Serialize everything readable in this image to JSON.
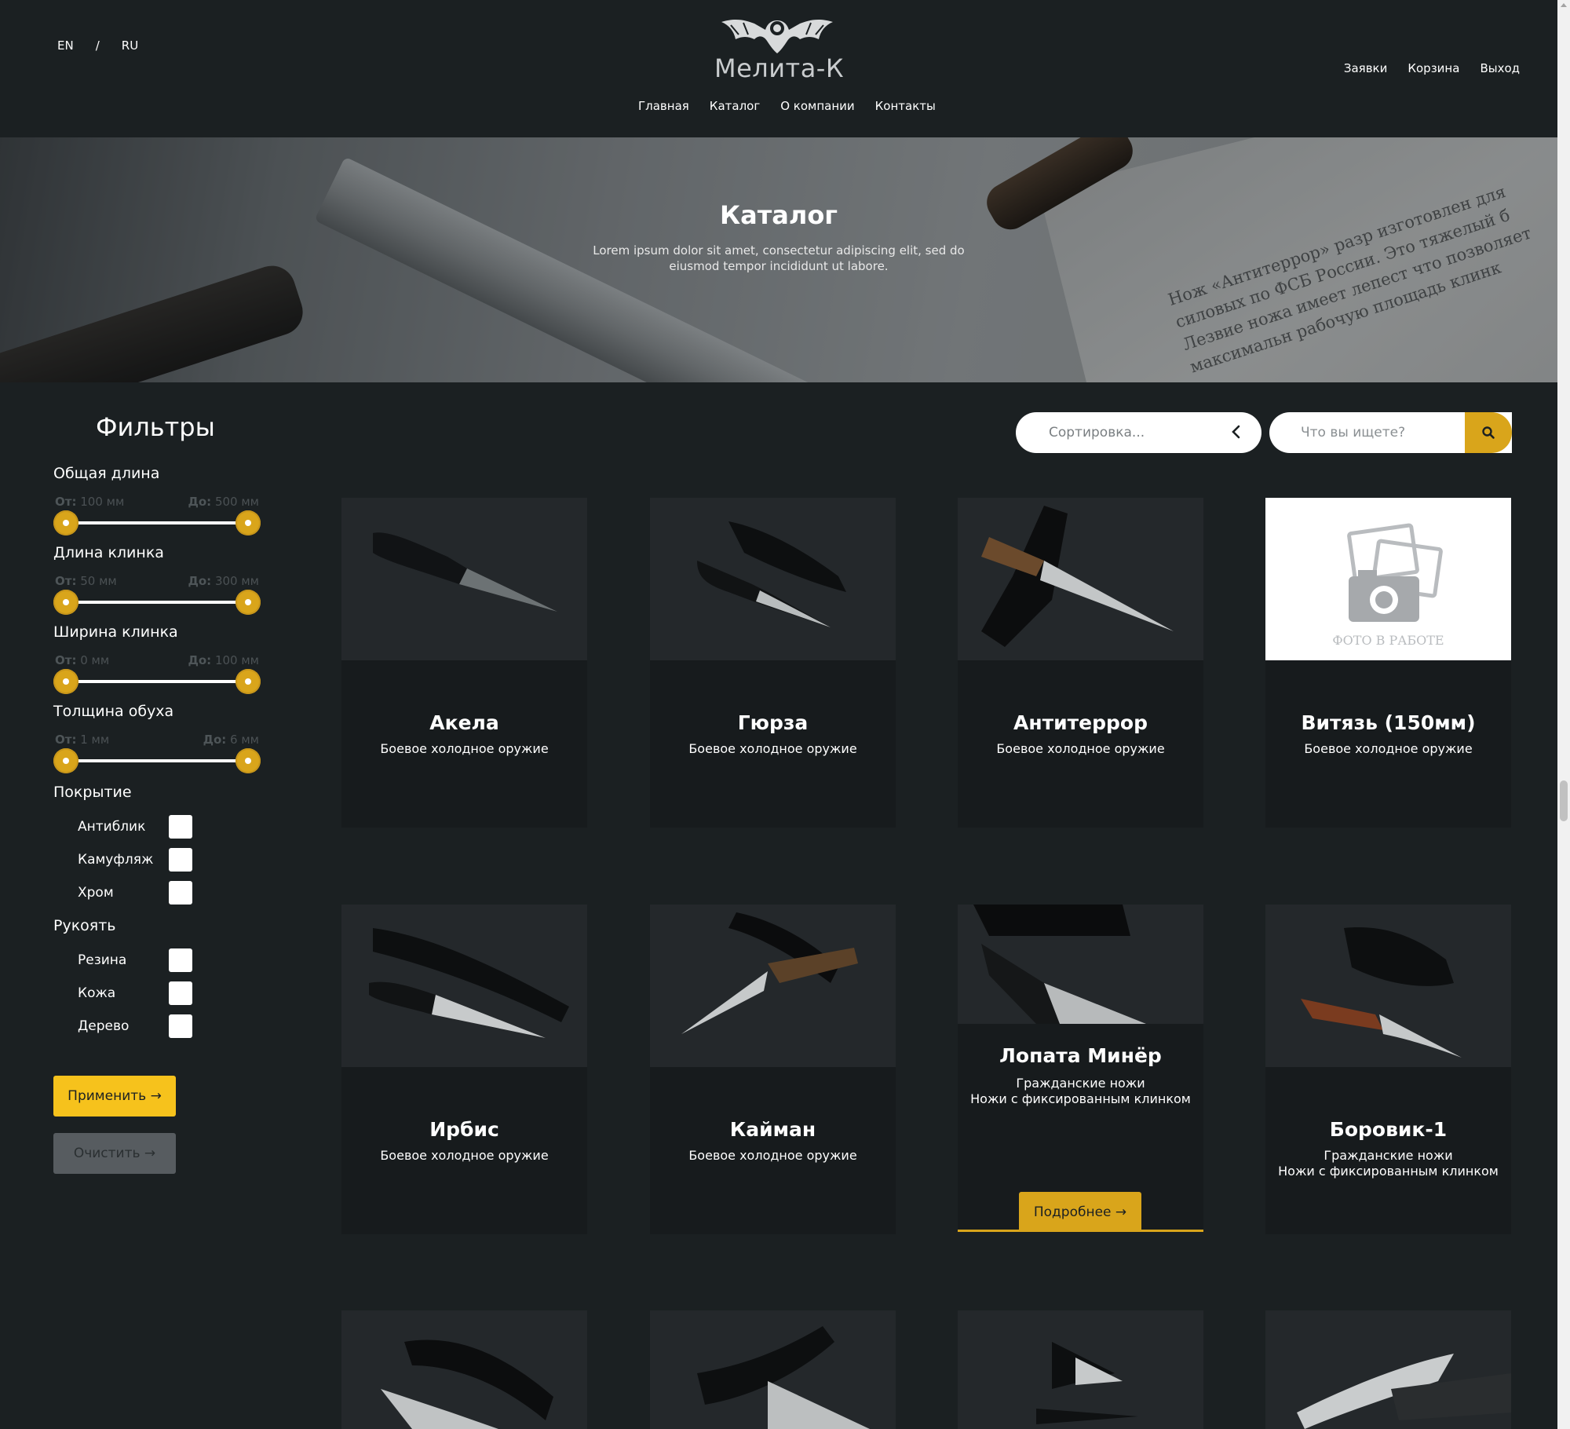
{
  "header": {
    "lang": {
      "en": "EN",
      "sep": "/",
      "ru": "RU"
    },
    "logo_text": "Мелита-К",
    "main_nav": [
      "Главная",
      "Каталог",
      "О компании",
      "Контакты"
    ],
    "user_nav": [
      "Заявки",
      "Корзина",
      "Выход"
    ]
  },
  "hero": {
    "title": "Каталог",
    "subtitle": "Lorem ipsum dolor sit amet, consectetur adipiscing elit, sed do eiusmod tempor incididunt ut labore.",
    "paper_text": "Нож «Антитеррор» разр изготовлен для силовых по ФСБ России. Это тяжелый б Лезвие ножа имеет лепест что позволяет максимальн рабочую площадь клинк"
  },
  "filters": {
    "title": "Фильтры",
    "ranges": [
      {
        "label": "Общая длина",
        "from_prefix": "От:",
        "from": "100 мм",
        "to_prefix": "До:",
        "to": "500 мм"
      },
      {
        "label": "Длина клинка",
        "from_prefix": "От:",
        "from": "50 мм",
        "to_prefix": "До:",
        "to": "300 мм"
      },
      {
        "label": "Ширина клинка",
        "from_prefix": "От:",
        "from": "0 мм",
        "to_prefix": "До:",
        "to": "100 мм"
      },
      {
        "label": "Толщина обуха",
        "from_prefix": "От:",
        "from": "1 мм",
        "to_prefix": "До:",
        "to": "6 мм"
      }
    ],
    "coating": {
      "label": "Покрытие",
      "options": [
        "Антиблик",
        "Камуфляж",
        "Хром"
      ]
    },
    "handle": {
      "label": "Рукоять",
      "options": [
        "Резина",
        "Кожа",
        "Дерево"
      ]
    },
    "apply_label": "Применить →",
    "clear_label": "Очистить →"
  },
  "toolbar": {
    "sort_placeholder": "Сортировка...",
    "search_placeholder": "Что вы ищете?"
  },
  "products": [
    {
      "title": "Акела",
      "lines": [
        "Боевое холодное оружие"
      ]
    },
    {
      "title": "Гюрза",
      "lines": [
        "Боевое холодное оружие"
      ]
    },
    {
      "title": "Антитеррор",
      "lines": [
        "Боевое холодное оружие"
      ]
    },
    {
      "title": "Витязь (150мм)",
      "lines": [
        "Боевое холодное оружие"
      ],
      "placeholder_caption": "ФОТО В РАБОТЕ"
    },
    {
      "title": "Ирбис",
      "lines": [
        "Боевое холодное оружие"
      ]
    },
    {
      "title": "Кайман",
      "lines": [
        "Боевое холодное оружие"
      ]
    },
    {
      "title": "Лопата Минёр",
      "lines": [
        "Гражданские ножи",
        "Ножи с фиксированным клинком"
      ],
      "button": "Подробнее →"
    },
    {
      "title": "Боровик-1",
      "lines": [
        "Гражданские ножи",
        "Ножи с фиксированным клинком"
      ]
    }
  ],
  "colors": {
    "accent": "#d9a51b",
    "background": "#1b2022",
    "card": "#171b1d"
  }
}
